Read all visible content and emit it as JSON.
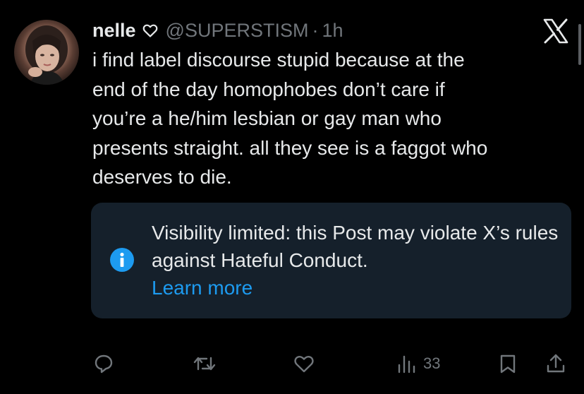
{
  "author": {
    "display_name": "nelle",
    "handle": "@SUPERSTISM",
    "separator": "·",
    "time": "1h"
  },
  "tweet": {
    "text": "i find label discourse stupid because at the\nend of the day homophobes don’t care if\nyou’re a he/him lesbian or gay man who\npresents straight. all they see is a faggot who\ndeserves to die."
  },
  "notice": {
    "message": "Visibility limited: this Post may violate X’s rules against Hateful Conduct.",
    "link_label": "Learn more"
  },
  "actions": {
    "views_count": "33"
  },
  "icons": {
    "header": [
      "heart-outline-icon",
      "x-logo-icon"
    ],
    "notice": "info-icon",
    "actions": [
      "reply-icon",
      "repost-icon",
      "like-icon",
      "views-icon",
      "bookmark-icon",
      "share-icon"
    ]
  },
  "colors": {
    "background": "#000000",
    "text_primary": "#e7e9ea",
    "text_secondary": "#71767b",
    "accent": "#1d9bf0",
    "notice_background": "#15202b"
  }
}
